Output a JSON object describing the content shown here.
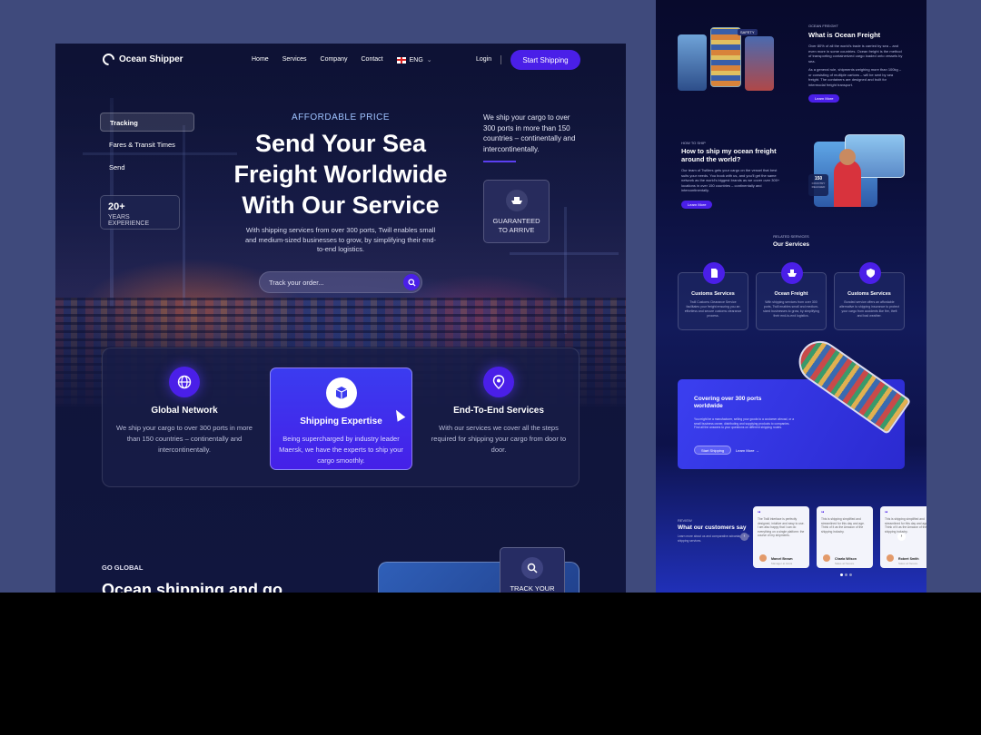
{
  "nav": {
    "brand": "Ocean Shipper",
    "links": [
      "Home",
      "Services",
      "Company",
      "Contact"
    ],
    "lang": "ENG",
    "login": "Login",
    "cta": "Start Shipping"
  },
  "sidebar": {
    "tabs": [
      "Tracking",
      "Fares & Transit Times",
      "Send"
    ],
    "experience_number": "20+",
    "experience_label": "YEARS EXPERIENCE"
  },
  "hero": {
    "eyebrow": "AFFORDABLE PRICE",
    "title_lines": [
      "Send Your Sea",
      "Freight Worldwide",
      "With Our Service"
    ],
    "subtitle": "With shipping services from over 300 ports, Twill enables small and medium-sized businesses to grow, by simplifying their end-to-end logistics.",
    "search_placeholder": "Track your order...",
    "right_text": "We ship your cargo to over 300 ports in more than 150 countries – continentally and intercontinentally.",
    "guarantee_line1": "GUARANTEED",
    "guarantee_line2": "TO ARRIVE"
  },
  "features": [
    {
      "title": "Global Network",
      "desc": "We ship your cargo to over 300 ports in more than 150 countries – continentally and intercontinentally.",
      "icon": "globe-icon"
    },
    {
      "title": "Shipping Expertise",
      "desc": "Being supercharged by industry leader Maersk, we have the experts to ship your cargo smoothly.",
      "icon": "box-icon"
    },
    {
      "title": "End-To-End Services",
      "desc": "With our services we cover all the steps required for shipping your cargo from door to door.",
      "icon": "location-pin-icon"
    }
  ],
  "bottom": {
    "eyebrow": "GO GLOBAL",
    "heading": "Ocean shipping and go",
    "track_label": "TRACK YOUR"
  },
  "preview": {
    "s1_eyebrow": "OCEAN FREIGHT",
    "s1_title": "What is Ocean Freight",
    "s1_badge": "SAFETY",
    "s1_body": "Over 80% of all the world's trade is carried by sea – and even more in some countries. Ocean freight is the method of transporting containerized cargo loaded onto vessels by sea.",
    "s1_body2": "As a general rule, shipments weighing more than 100kg – or consisting of multiple cartons – will be sent by sea freight. The containers are designed and built for intermodal freight transport.",
    "learn_more": "Learn More",
    "s2_eyebrow": "HOW TO SHIP",
    "s2_title": "How to ship my ocean freight around the world?",
    "s2_body": "Our team of Twillers gets your cargo on the vessel that best suits your needs. You book with us, and you'll get the same network as the world's biggest brands as we cover over 300+ locations in over 150 countries – continentally and intercontinentally.",
    "s2_badge_num": "150",
    "s2_badge_label": "COUNTRY REACHED",
    "s3_eyebrow": "RELATED SERVICES",
    "s3_title": "Our Services",
    "services": [
      {
        "title": "Customs Services",
        "desc": "Twill Customs Clearance Service facilitates your freight ensuring you an effortless and secure customs clearance process.",
        "icon": "document-icon"
      },
      {
        "title": "Ocean Freight",
        "desc": "With shipping services from over 300 ports, Twill enables small and medium-sized businesses to grow, by simplifying their end-to-end logistics.",
        "icon": "ship-icon"
      },
      {
        "title": "Customs Services",
        "desc": "Bonded service offers an affordable alternative to shipping insurance to protect your cargo from accidents like fire, theft and bad weather.",
        "icon": "shield-icon"
      }
    ],
    "s4_title": "Covering over 300 ports worldwide",
    "s4_body": "You might be a manufacturer, selling your goods to a customer abroad, or a small business owner, distributing and supplying products to companies. Find all the answers to your questions on different shipping routes.",
    "s4_btn": "Start Shipping",
    "s4_link": "Learn More",
    "s5_eyebrow": "REVIEW",
    "s5_title": "What our customers say",
    "s5_body": "Learn more about us and comparative advantage by 5 shipping services.",
    "reviews": [
      {
        "text": "The Twill interface is perfectly designed, intuitive and easy to use. I am also happy that I can do everything on a single platform: the course of my shipments.",
        "name": "Marcel Brown",
        "role": "Manager at Aviva"
      },
      {
        "text": "This is shipping simplified and streamlined for this day and age. Think of it as the Amazon of the shipping industry.",
        "name": "Charla Wilson",
        "role": "Sales at Nexure"
      },
      {
        "text": "This is shipping simplified and streamlined for this day and age. Think of it as the Amazon of the shipping industry.",
        "name": "Robert Smith",
        "role": "Sales at Nexure"
      }
    ]
  },
  "colors": {
    "accent": "#4a1fe8",
    "background": "#0e1235",
    "stage": "#3f4a7c"
  }
}
